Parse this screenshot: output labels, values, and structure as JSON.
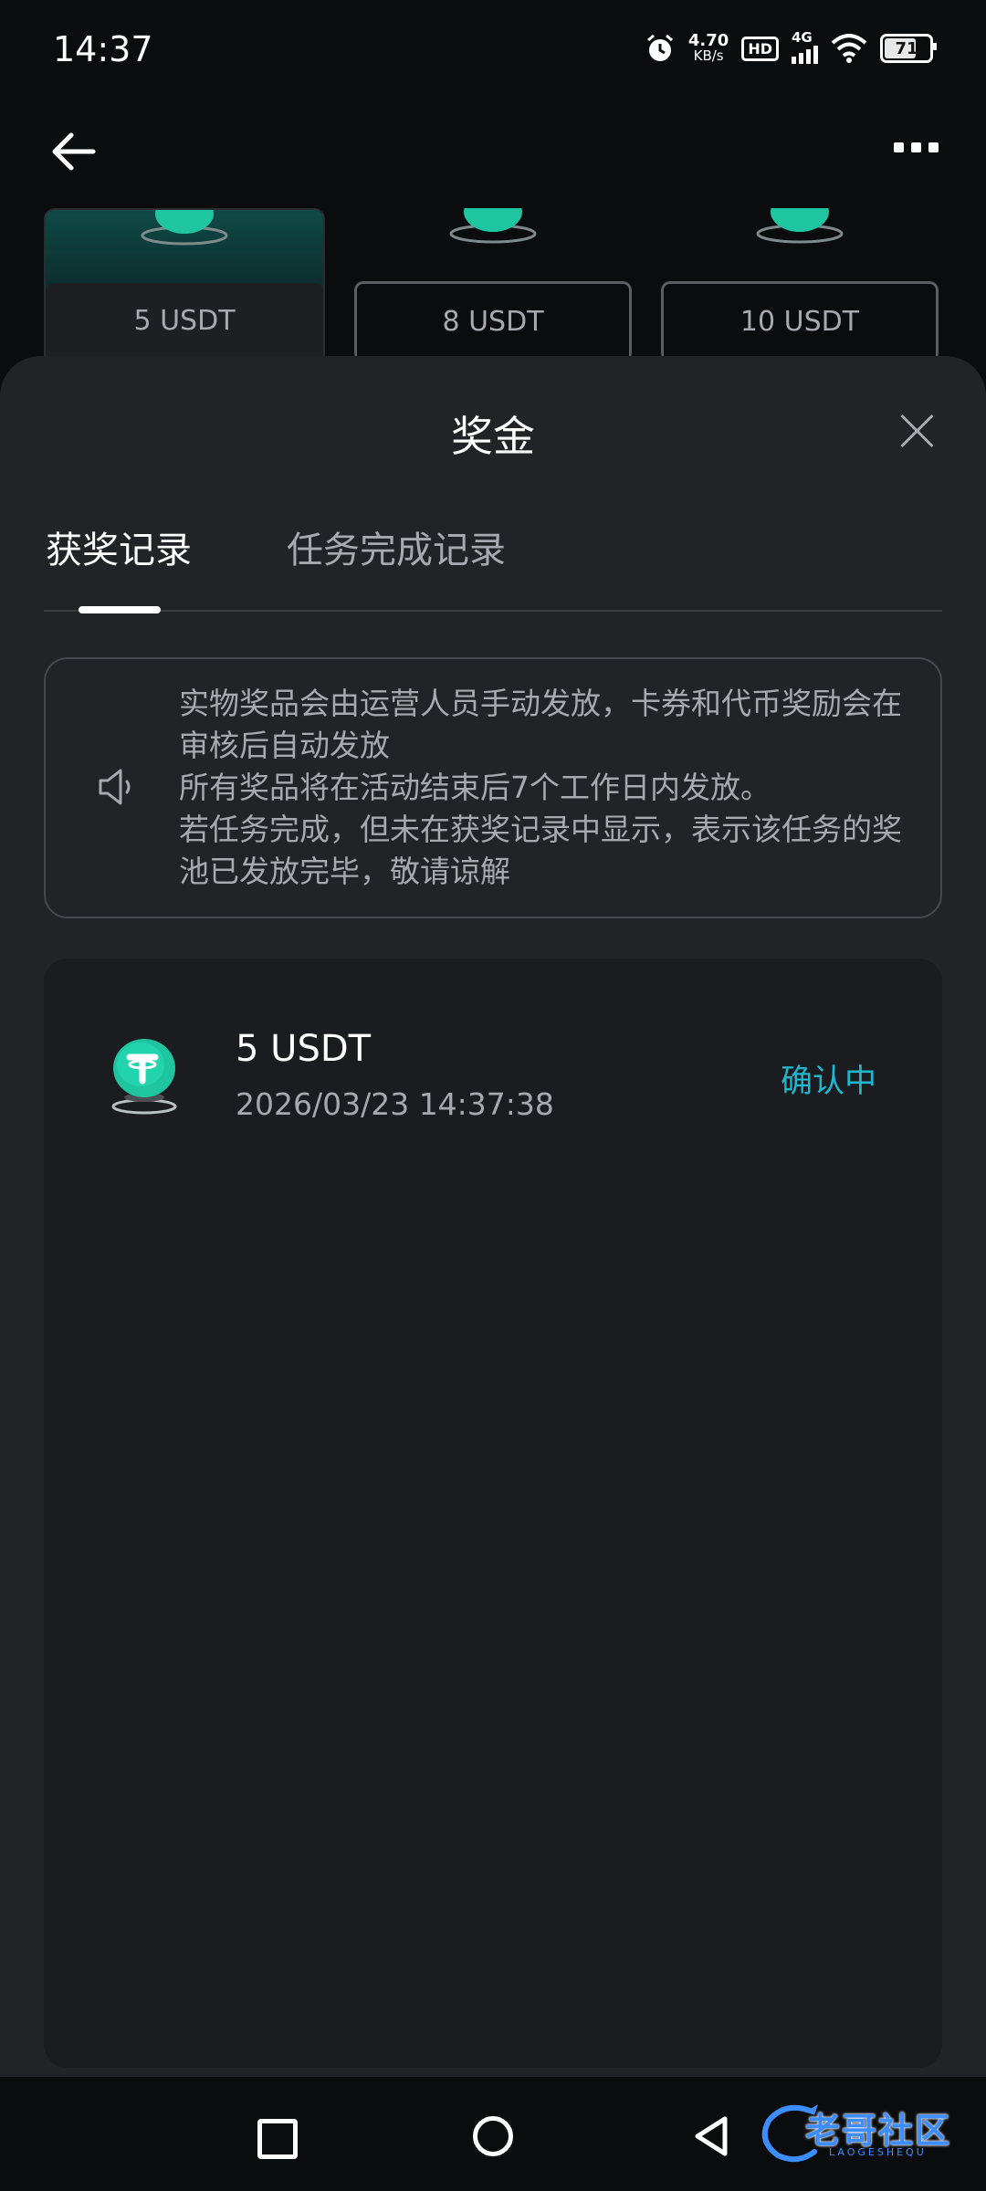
{
  "status_bar": {
    "time": "14:37",
    "net_speed": "4.70",
    "net_unit": "KB/s",
    "hd_label": "HD",
    "signal_label": "4G",
    "battery_level": "71"
  },
  "prize_cards": [
    {
      "label": "5 USDT",
      "selected": true
    },
    {
      "label": "8 USDT",
      "selected": false
    },
    {
      "label": "10 USDT",
      "selected": false
    }
  ],
  "sheet": {
    "title": "奖金",
    "tabs": [
      {
        "label": "获奖记录",
        "active": true
      },
      {
        "label": "任务完成记录",
        "active": false
      }
    ],
    "notice": {
      "lines": [
        "实物奖品会由运营人员手动发放，卡券和代币奖励会在审核后自动发放",
        "所有奖品将在活动结束后7个工作日内发放。",
        "若任务完成，但未在获奖记录中显示，表示该任务的奖池已发放完毕，敬请谅解"
      ]
    },
    "records": [
      {
        "amount": "5 USDT",
        "time": "2026/03/23 14:37:38",
        "status": "确认中"
      }
    ]
  },
  "colors": {
    "accent": "#1fb7d0",
    "sheet_bg": "#222326",
    "card_bg": "#1b1c1f",
    "coin": "#1fc4a1"
  },
  "watermark": {
    "text": "老哥社区",
    "sub": "LAOGESHEQU"
  }
}
